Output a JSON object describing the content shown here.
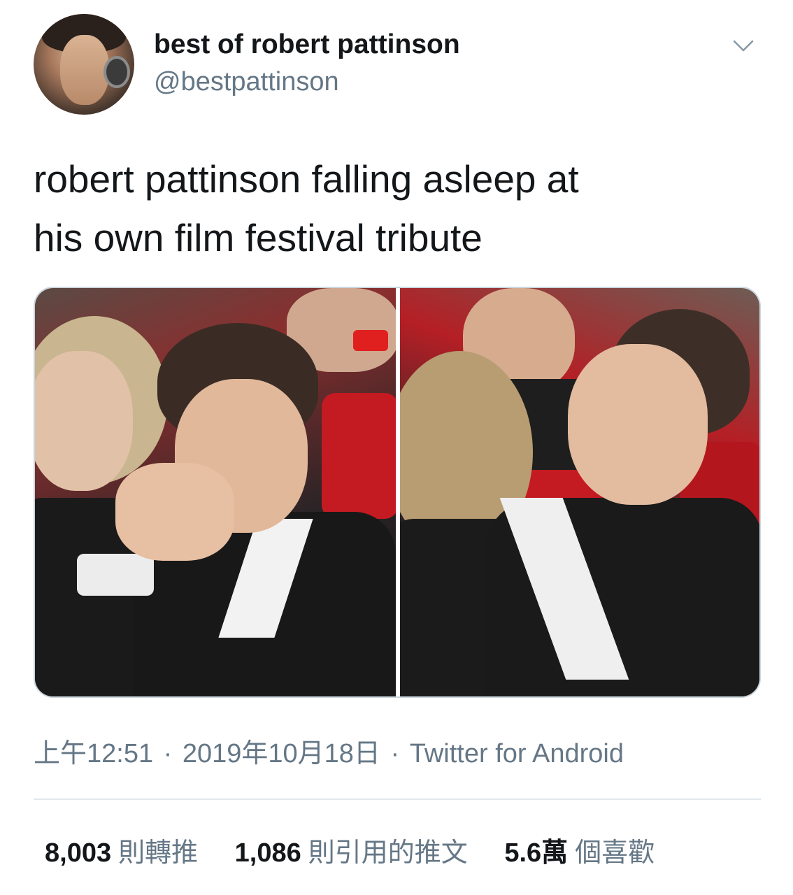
{
  "tweet": {
    "author": {
      "display_name": "best of robert pattinson",
      "handle": "@bestpattinson"
    },
    "text_line1": "robert pattinson falling asleep at",
    "text_line2": "his own film festival tribute",
    "media_count": 2,
    "meta": {
      "time": "上午12:51",
      "date": "2019年10月18日",
      "source": "Twitter for Android",
      "separator": "·"
    },
    "stats": [
      {
        "value": "8,003",
        "label": "則轉推"
      },
      {
        "value": "1,086",
        "label": "則引用的推文"
      },
      {
        "value": "5.6萬",
        "label": "個喜歡"
      }
    ]
  },
  "colors": {
    "text_primary": "#14171a",
    "text_secondary": "#657786",
    "divider": "#e1e8ed",
    "media_border": "#ccd6dd"
  },
  "icons": {
    "menu": "chevron-down-icon"
  }
}
